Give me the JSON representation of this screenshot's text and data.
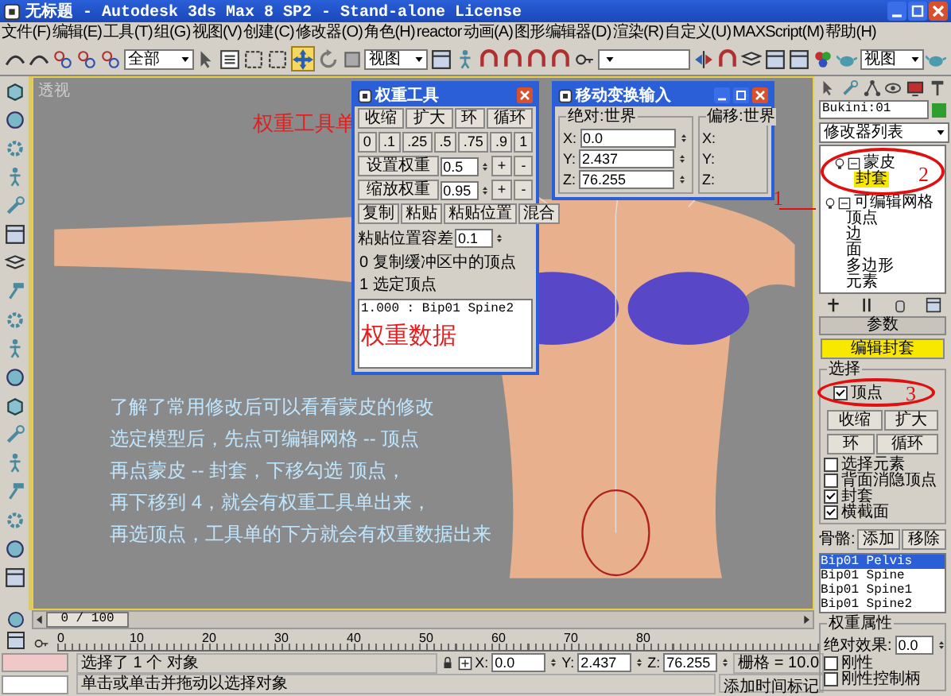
{
  "window": {
    "title": "无标题 - Autodesk 3ds Max 8 SP2  - Stand-alone License"
  },
  "menu": [
    "文件(F)",
    "编辑(E)",
    "工具(T)",
    "组(G)",
    "视图(V)",
    "创建(C)",
    "修改器(O)",
    "角色(H)",
    "reactor",
    "动画(A)",
    "图形编辑器(D)",
    "渲染(R)",
    "自定义(U)",
    "MAXScript(M)",
    "帮助(H)"
  ],
  "toolbar": {
    "selection_filter": "全部",
    "reference_coords": "视图",
    "render_type": "视图"
  },
  "viewport": {
    "label": "透视",
    "callout": "权重工具单",
    "instructions": [
      "了解了常用修改后可以看看蒙皮的修改",
      "选定模型后，先点可编辑网格 -- 顶点",
      "再点蒙皮 -- 封套，下移勾选 顶点，",
      "再下移到 4，就会有权重工具单出来，",
      "再选顶点，工具单的下方就会有权重数据出来"
    ]
  },
  "weight_tool": {
    "title": "权重工具",
    "select_buttons": [
      "收缩",
      "扩大",
      "环",
      "循环"
    ],
    "presets": [
      "0",
      ".1",
      ".25",
      ".5",
      ".75",
      ".9",
      "1"
    ],
    "set_weight": {
      "label": "设置权重",
      "value": "0.5"
    },
    "scale_weight": {
      "label": "缩放权重",
      "value": "0.95"
    },
    "adjust": [
      "+",
      "-"
    ],
    "copy_buttons": [
      "复制",
      "粘贴",
      "粘贴位置",
      "混合"
    ],
    "tolerance": {
      "label": "粘贴位置容差",
      "value": "0.1"
    },
    "buffer_info": "0 复制缓冲区中的顶点",
    "selected_info": "1 选定顶点",
    "weights": [
      "1.000 : Bip01 Spine2"
    ],
    "callout": "权重数据"
  },
  "transform_input": {
    "title": "移动变换输入",
    "absolute": {
      "label": "绝对:世界",
      "fields": [
        {
          "axis": "X:",
          "value": "0.0"
        },
        {
          "axis": "Y:",
          "value": "2.437"
        },
        {
          "axis": "Z:",
          "value": "76.255"
        }
      ]
    },
    "offset": {
      "label": "偏移:世界",
      "axes": [
        "X:",
        "Y:",
        "Z:"
      ]
    }
  },
  "command_panel": {
    "object_name": "Bukini:01",
    "modifier_list": "修改器列表",
    "stack": [
      {
        "label": "蒙皮",
        "selected": false,
        "children": [
          {
            "label": "封套",
            "selected": true
          }
        ]
      },
      {
        "label": "可编辑网格",
        "selected": false,
        "children": [
          {
            "label": "顶点",
            "selected": false
          },
          {
            "label": "边",
            "selected": false
          },
          {
            "label": "面",
            "selected": false
          },
          {
            "label": "多边形",
            "selected": false
          },
          {
            "label": "元素",
            "selected": false
          }
        ]
      }
    ],
    "rollout": "参数",
    "edit_envelope": "编辑封套",
    "selection_group": "选择",
    "vertices": {
      "label": "顶点",
      "checked": true
    },
    "select_buttons": [
      "收缩",
      "扩大",
      "环",
      "循环"
    ],
    "options": [
      {
        "label": "选择元素",
        "checked": false
      },
      {
        "label": "背面消隐顶点",
        "checked": false
      },
      {
        "label": "封套",
        "checked": true
      },
      {
        "label": "横截面",
        "checked": true
      }
    ],
    "bones_label": "骨骼:",
    "bone_buttons": [
      "添加",
      "移除"
    ],
    "bones": [
      {
        "label": "Bip01 Pelvis",
        "selected": true
      },
      {
        "label": "Bip01 Spine",
        "selected": false
      },
      {
        "label": "Bip01 Spine1",
        "selected": false
      },
      {
        "label": "Bip01 Spine2",
        "selected": false
      }
    ],
    "weight_properties": {
      "title": "权重属性",
      "label": "绝对效果:",
      "value": "0.0",
      "options": [
        {
          "label": "刚性",
          "checked": false
        },
        {
          "label": "刚性控制柄",
          "checked": false
        }
      ]
    },
    "callouts": [
      "1",
      "2",
      "3"
    ]
  },
  "time_slider": {
    "position": "0 / 100",
    "level": 0
  },
  "track_bar": {
    "ticks": [
      "0",
      "10",
      "20",
      "30",
      "40",
      "50",
      "60",
      "70",
      "80"
    ]
  },
  "status_bar": {
    "selection": "选择了 1 个 对象",
    "coords": [
      {
        "axis": "X:",
        "value": "0.0"
      },
      {
        "axis": "Y:",
        "value": "2.437"
      },
      {
        "axis": "Z:",
        "value": "76.255"
      }
    ],
    "grid": "栅格 = 10.0",
    "prompt": "单击或单击并拖动以选择对象",
    "time_tag": "添加时间标记"
  }
}
